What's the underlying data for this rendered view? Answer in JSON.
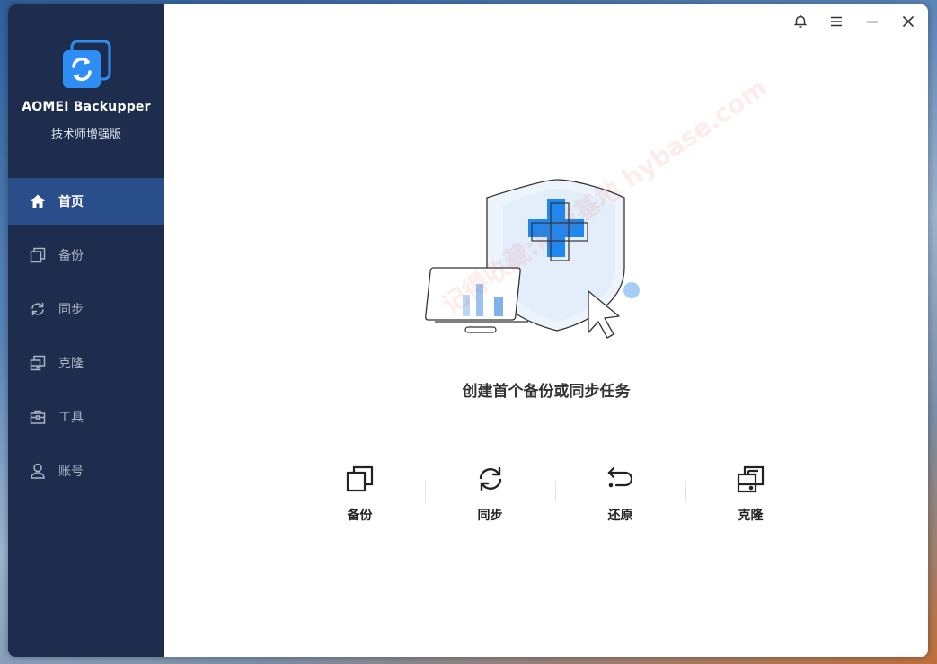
{
  "app": {
    "name": "AOMEI Backupper",
    "edition": "技术师增强版"
  },
  "sidebar": {
    "items": [
      {
        "label": "首页",
        "icon": "home-icon",
        "active": true
      },
      {
        "label": "备份",
        "icon": "backup-icon",
        "active": false
      },
      {
        "label": "同步",
        "icon": "sync-icon",
        "active": false
      },
      {
        "label": "克隆",
        "icon": "clone-icon",
        "active": false
      },
      {
        "label": "工具",
        "icon": "toolbox-icon",
        "active": false
      },
      {
        "label": "账号",
        "icon": "user-icon",
        "active": false
      }
    ]
  },
  "titlebar": {
    "buttons": [
      "bell-icon",
      "menu-icon",
      "minimize-icon",
      "close-icon"
    ]
  },
  "main": {
    "hero_title": "创建首个备份或同步任务",
    "actions": [
      {
        "label": "备份",
        "icon": "backup-icon"
      },
      {
        "label": "同步",
        "icon": "sync-icon"
      },
      {
        "label": "还原",
        "icon": "restore-icon"
      },
      {
        "label": "克隆",
        "icon": "clone-icon"
      }
    ]
  },
  "watermark": "记得收藏:黑域基地 hybase.com",
  "colors": {
    "sidebar_bg": "#1e2d4d",
    "sidebar_active": "#2a4e8a",
    "accent": "#1e88f0"
  }
}
